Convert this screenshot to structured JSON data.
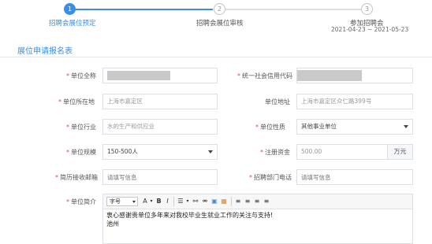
{
  "stepper": {
    "steps": [
      {
        "number": "1",
        "label": "招聘会展位预定",
        "state": "active"
      },
      {
        "number": "2",
        "label": "招聘会展位审核",
        "state": "pending"
      },
      {
        "number": "3",
        "label": "参加招聘会",
        "state": "pending"
      }
    ],
    "date_range": "2021-04-23 ~ 2021-05-23",
    "active_color": "#3a8ee6"
  },
  "section": {
    "title": "展位申请报名表"
  },
  "form": {
    "unit_name": {
      "label": "单位全称",
      "value": ""
    },
    "credit_code": {
      "label": "统一社会信用代码",
      "value": ""
    },
    "location": {
      "label": "单位所在地",
      "value": "上海市嘉定区"
    },
    "address": {
      "label": "单位地址",
      "value": "上海市嘉定区众仁路399号"
    },
    "industry": {
      "label": "单位行业",
      "value": "水的生产和供应业"
    },
    "nature": {
      "label": "单位性质",
      "value": "其他事业单位"
    },
    "scale": {
      "label": "单位规模",
      "value": "150-500人"
    },
    "capital": {
      "label": "注册资金",
      "value": "500.00",
      "unit": "万元"
    },
    "resume_email": {
      "label": "简历接收邮箱",
      "placeholder": "请填写信息"
    },
    "hr_phone": {
      "label": "招聘部门电话",
      "placeholder": "请填写信息"
    },
    "intro": {
      "label": "单位简介",
      "toolbar": {
        "font_select": "字号",
        "font_color": "A",
        "bold": "B",
        "italic": "I"
      },
      "lines": [
        "衷心感谢贵单位多年来对我校毕业生就业工作的关注与支持!",
        "池州"
      ]
    }
  }
}
